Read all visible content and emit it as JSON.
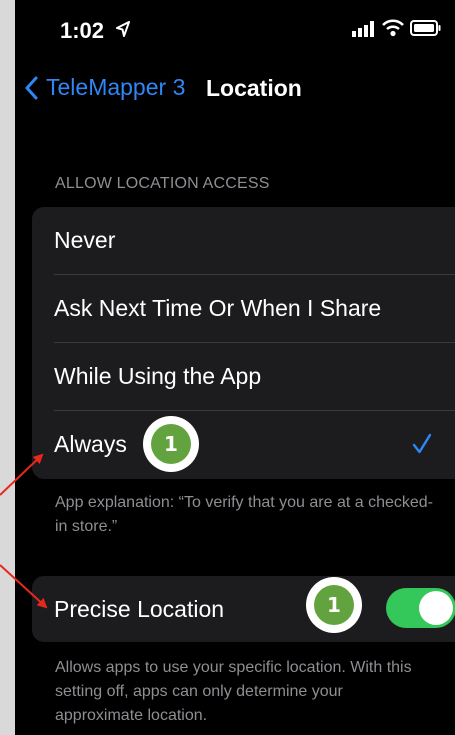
{
  "status_bar": {
    "time": "1:02"
  },
  "nav": {
    "back_label": "TeleMapper 3",
    "title": "Location"
  },
  "location_access": {
    "header": "ALLOW LOCATION ACCESS",
    "options": [
      {
        "label": "Never",
        "selected": false
      },
      {
        "label": "Ask Next Time Or When I Share",
        "selected": false
      },
      {
        "label": "While Using the App",
        "selected": false
      },
      {
        "label": "Always",
        "selected": true
      }
    ],
    "explanation": "App explanation: “To verify that you are at a checked-in store.”"
  },
  "precise_location": {
    "label": "Precise Location",
    "enabled": true,
    "description": "Allows apps to use your specific location. With this setting off, apps can only determine your approximate location."
  },
  "annotations": {
    "badge_always": "1",
    "badge_precise": "1"
  },
  "colors": {
    "accent": "#2f86f5",
    "toggle_on": "#34c759",
    "badge": "#63a33f",
    "arrow": "#e8281e"
  }
}
